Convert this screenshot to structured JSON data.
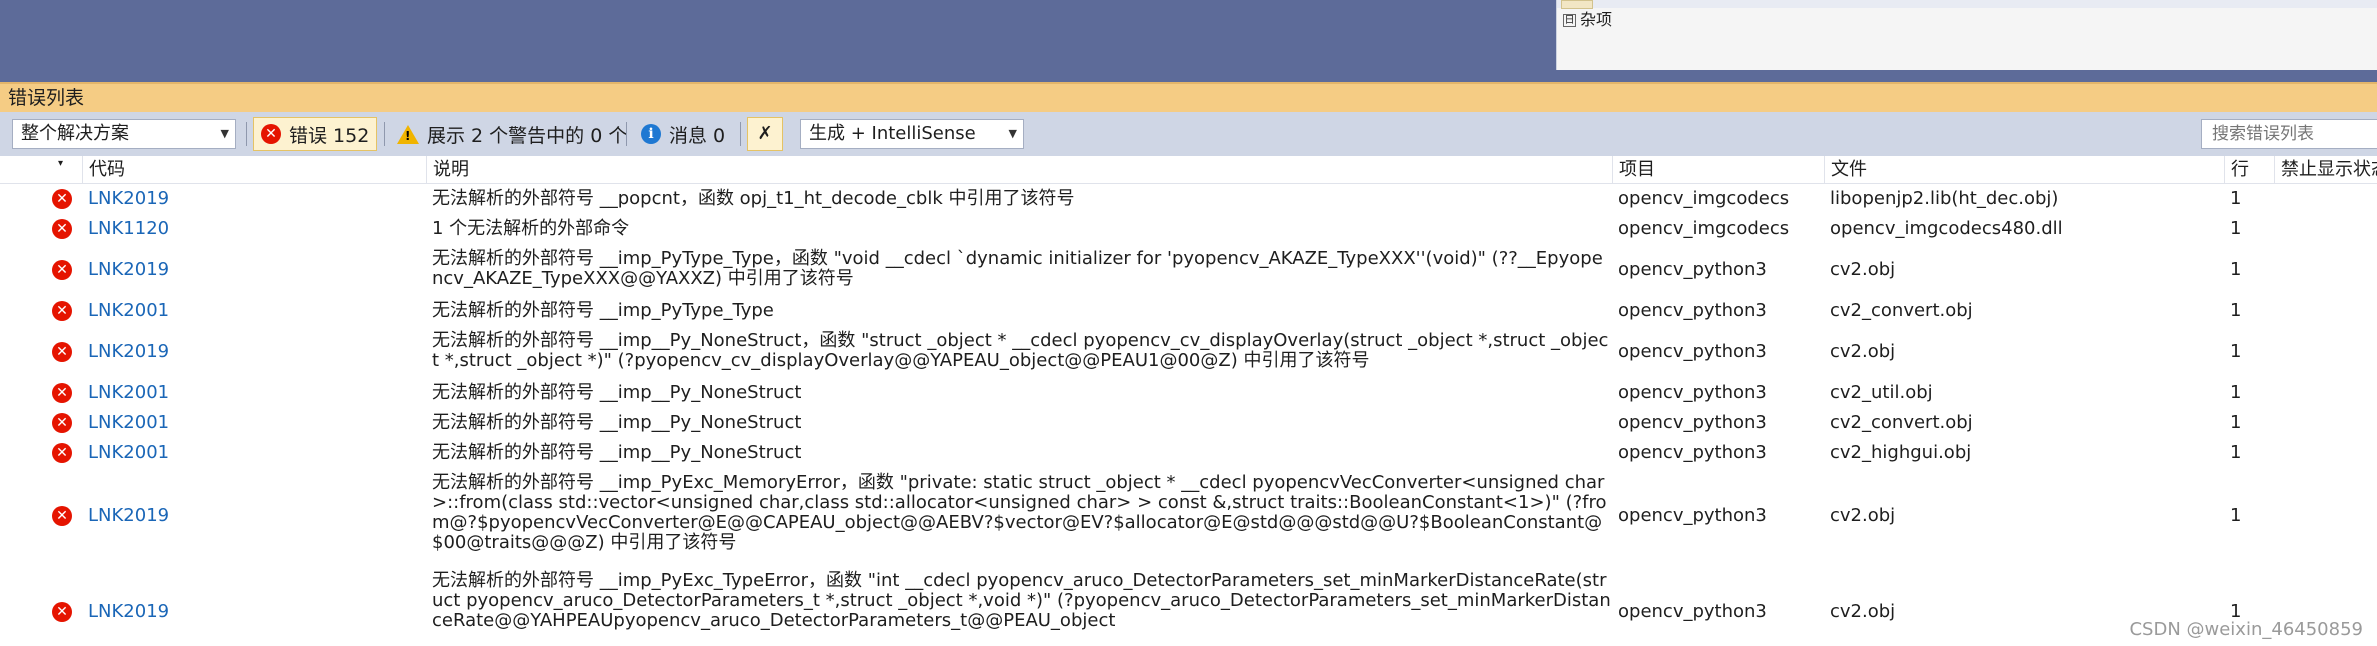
{
  "properties_panel": {
    "row_label": "杂项",
    "expander": "日"
  },
  "window": {
    "title": "错误列表"
  },
  "toolbar": {
    "scope_value": "整个解决方案",
    "errors_label": "错误 152",
    "warnings_label": "展示 2 个警告中的 0 个",
    "messages_label": "消息 0",
    "build_filter_value": "生成 + IntelliSense",
    "search_placeholder": "搜索错误列表"
  },
  "columns": {
    "code": "代码",
    "description": "说明",
    "project": "项目",
    "file": "文件",
    "line": "行",
    "suppression": "禁止显示状态"
  },
  "rows": [
    {
      "code": "LNK2019",
      "description": "无法解析的外部符号 __popcnt，函数 opj_t1_ht_decode_cblk 中引用了该符号",
      "project": "opencv_imgcodecs",
      "file": "libopenjp2.lib(ht_dec.obj)",
      "line": "1"
    },
    {
      "code": "LNK1120",
      "description": "1 个无法解析的外部命令",
      "project": "opencv_imgcodecs",
      "file": "opencv_imgcodecs480.dll",
      "line": "1"
    },
    {
      "code": "LNK2019",
      "description": "无法解析的外部符号 __imp_PyType_Type，函数 \"void __cdecl `dynamic initializer for 'pyopencv_AKAZE_TypeXXX''(void)\" (??__Epyopencv_AKAZE_TypeXXX@@YAXXZ) 中引用了该符号",
      "project": "opencv_python3",
      "file": "cv2.obj",
      "line": "1"
    },
    {
      "code": "LNK2001",
      "description": "无法解析的外部符号 __imp_PyType_Type",
      "project": "opencv_python3",
      "file": "cv2_convert.obj",
      "line": "1"
    },
    {
      "code": "LNK2019",
      "description": "无法解析的外部符号 __imp__Py_NoneStruct，函数 \"struct _object * __cdecl pyopencv_cv_displayOverlay(struct _object *,struct _object *,struct _object *)\" (?pyopencv_cv_displayOverlay@@YAPEAU_object@@PEAU1@00@Z) 中引用了该符号",
      "project": "opencv_python3",
      "file": "cv2.obj",
      "line": "1"
    },
    {
      "code": "LNK2001",
      "description": "无法解析的外部符号 __imp__Py_NoneStruct",
      "project": "opencv_python3",
      "file": "cv2_util.obj",
      "line": "1"
    },
    {
      "code": "LNK2001",
      "description": "无法解析的外部符号 __imp__Py_NoneStruct",
      "project": "opencv_python3",
      "file": "cv2_convert.obj",
      "line": "1"
    },
    {
      "code": "LNK2001",
      "description": "无法解析的外部符号 __imp__Py_NoneStruct",
      "project": "opencv_python3",
      "file": "cv2_highgui.obj",
      "line": "1"
    },
    {
      "code": "LNK2019",
      "description": "无法解析的外部符号 __imp_PyExc_MemoryError，函数 \"private: static struct _object * __cdecl pyopencvVecConverter<unsigned char>::from(class std::vector<unsigned char,class std::allocator<unsigned char> > const &,struct traits::BooleanConstant<1>)\" (?from@?$pyopencvVecConverter@E@@CAPEAU_object@@AEBV?$vector@EV?$allocator@E@std@@@std@@U?$BooleanConstant@$00@traits@@@Z) 中引用了该符号",
      "project": "opencv_python3",
      "file": "cv2.obj",
      "line": "1"
    },
    {
      "code": "LNK2019",
      "description": "无法解析的外部符号 __imp_PyExc_TypeError，函数 \"int __cdecl pyopencv_aruco_DetectorParameters_set_minMarkerDistanceRate(struct pyopencv_aruco_DetectorParameters_t *,struct _object *,void *)\" (?pyopencv_aruco_DetectorParameters_set_minMarkerDistanceRate@@YAHPEAUpyopencv_aruco_DetectorParameters_t@@PEAU_object",
      "project": "opencv_python3",
      "file": "cv2.obj",
      "line": "1"
    }
  ],
  "watermark": "CSDN @weixin_46450859",
  "colors": {
    "error": "#e51400",
    "warning": "#f0b400",
    "info": "#1e78d2",
    "title_bar": "#f5cc84",
    "code_link": "#1a66b7"
  }
}
